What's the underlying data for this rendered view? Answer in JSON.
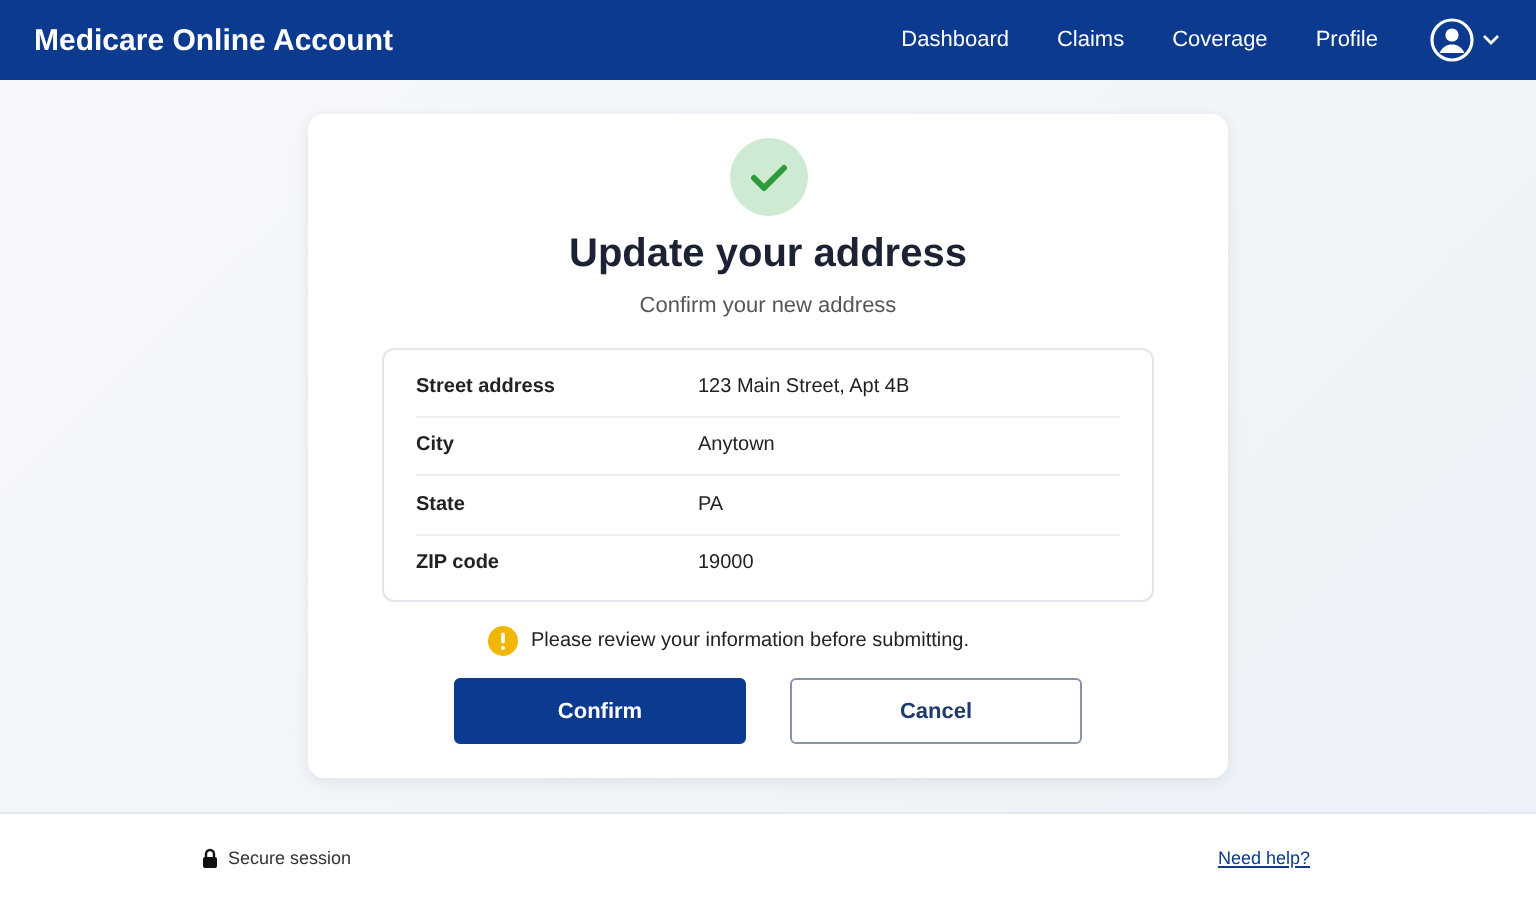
{
  "header": {
    "title": "Medicare Online Account",
    "nav": [
      {
        "label": "Dashboard"
      },
      {
        "label": "Claims"
      },
      {
        "label": "Coverage"
      },
      {
        "label": "Profile"
      }
    ]
  },
  "card": {
    "title": "Update your address",
    "subtitle": "Confirm your new address",
    "rows": [
      {
        "label": "Street address",
        "value": "123 Main Street, Apt 4B"
      },
      {
        "label": "City",
        "value": "Anytown"
      },
      {
        "label": "State",
        "value": "PA"
      },
      {
        "label": "ZIP code",
        "value": "19000"
      }
    ],
    "notice": "Please review your information before submitting.",
    "buttons": [
      {
        "label": "Confirm",
        "kind": "primary"
      },
      {
        "label": "Cancel",
        "kind": "secondary"
      }
    ]
  },
  "footer": {
    "status": "Secure session",
    "link": "Need help?"
  }
}
